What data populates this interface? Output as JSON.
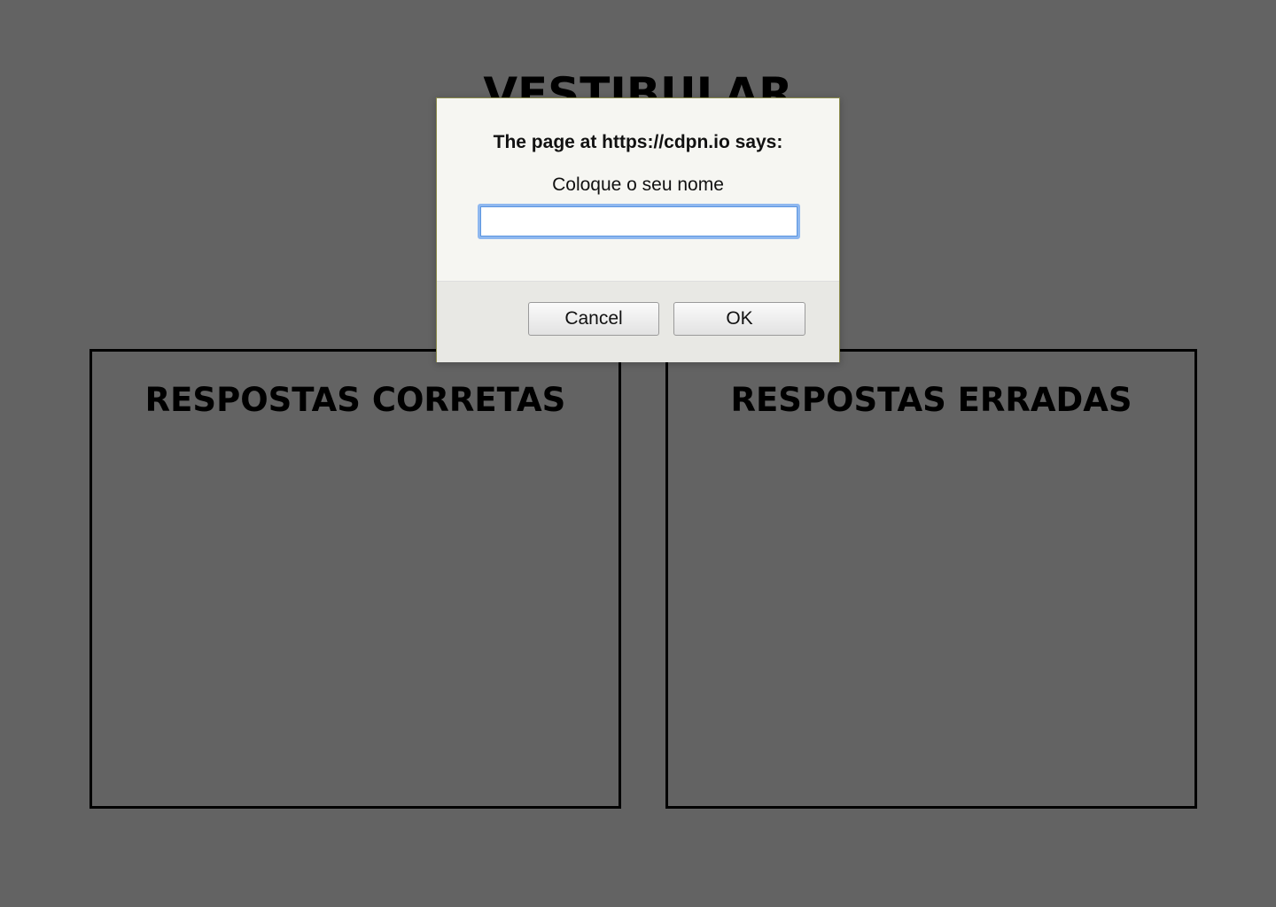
{
  "page": {
    "title": "VESTIBULAR"
  },
  "panels": {
    "correct_title": "RESPOSTAS CORRETAS",
    "wrong_title": "RESPOSTAS ERRADAS"
  },
  "dialog": {
    "heading": "The page at https://cdpn.io says:",
    "message": "Coloque o seu nome",
    "input_value": "",
    "cancel_label": "Cancel",
    "ok_label": "OK"
  },
  "colors": {
    "background": "#636363",
    "dialog_background": "#f6f6f2",
    "input_focus": "#8fb8ef"
  }
}
